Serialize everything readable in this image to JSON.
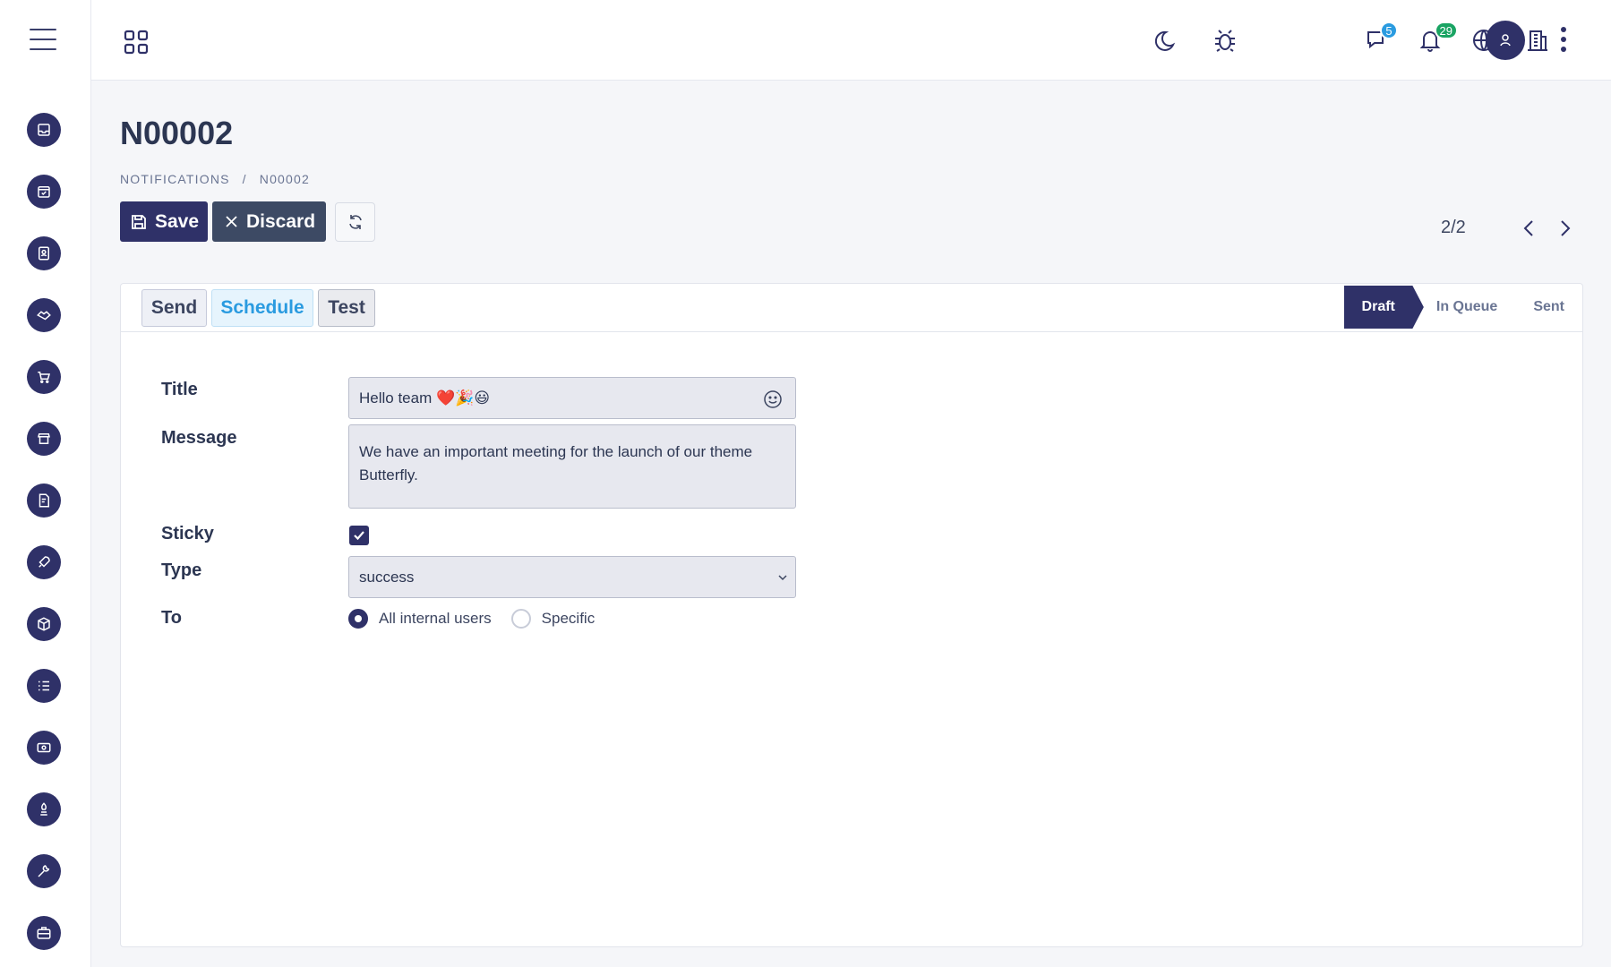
{
  "app": {
    "sidebar_icons": [
      "inbox-icon",
      "calendar-check-icon",
      "contacts-icon",
      "handshake-icon",
      "cart-icon",
      "store-icon",
      "invoice-icon",
      "rocket-icon",
      "package-icon",
      "list-icon",
      "money-icon",
      "bishop-icon",
      "wrench-icon",
      "briefcase-icon"
    ]
  },
  "topbar": {
    "icons": [
      "moon-icon",
      "bug-icon",
      "chat-icon",
      "bell-icon",
      "globe-icon",
      "building-icon"
    ],
    "chat_badge": "5",
    "bell_badge": "29",
    "badge_colors": {
      "chat": "#2a9be0",
      "bell": "#1aa463"
    }
  },
  "page": {
    "title": "N00002",
    "breadcrumb": {
      "parent": "Notifications",
      "current": "N00002"
    }
  },
  "toolbar": {
    "save_label": "Save",
    "discard_label": "Discard",
    "pager": "2/2"
  },
  "form": {
    "actions": {
      "send": "Send",
      "schedule": "Schedule",
      "test": "Test"
    },
    "statuses": [
      {
        "label": "Draft",
        "active": true
      },
      {
        "label": "In Queue",
        "active": false
      },
      {
        "label": "Sent",
        "active": false
      }
    ],
    "fields": {
      "title_label": "Title",
      "title_value": "Hello team ❤️🎉😃",
      "message_label": "Message",
      "message_value": "We have an important meeting for the launch of our theme Butterfly.",
      "sticky_label": "Sticky",
      "sticky_checked": true,
      "type_label": "Type",
      "type_value": "success",
      "to_label": "To",
      "to_options": [
        {
          "label": "All internal users",
          "checked": true
        },
        {
          "label": "Specific",
          "checked": false
        }
      ]
    }
  },
  "colors": {
    "primary": "#2f3168",
    "accent": "#2a9be0"
  }
}
